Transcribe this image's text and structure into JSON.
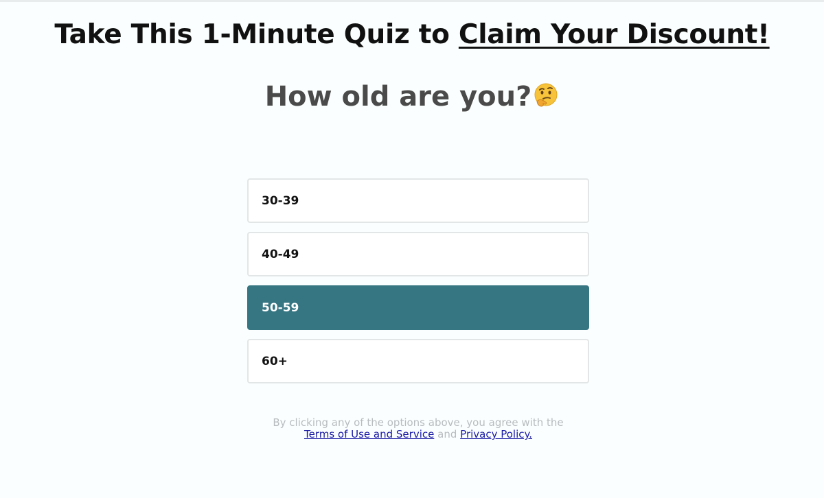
{
  "headline": {
    "prefix": "Take This 1-Minute Quiz to ",
    "link": "Claim Your Discount!"
  },
  "question": {
    "text": "How old are you?",
    "emoji_icon": "thinking-face-icon"
  },
  "options": [
    {
      "label": "30-39",
      "selected": false
    },
    {
      "label": "40-49",
      "selected": false
    },
    {
      "label": "50-59",
      "selected": true
    },
    {
      "label": "60+",
      "selected": false
    }
  ],
  "disclaimer": {
    "line1": "By clicking any of the options above, you agree with the",
    "terms_link": "Terms of Use and Service",
    "and_text": "and",
    "privacy_link": "Privacy Policy."
  },
  "colors": {
    "selected_option": "#367582",
    "link": "#1a1aa6",
    "background": "#fbfefe"
  }
}
